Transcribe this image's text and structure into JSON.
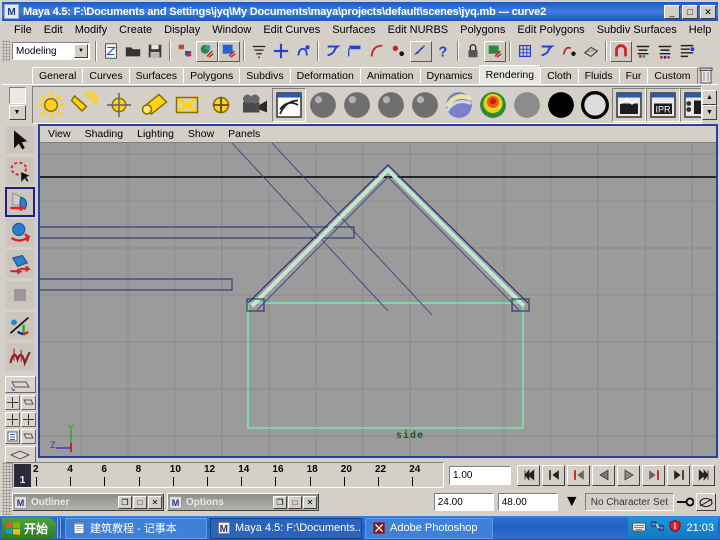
{
  "window": {
    "icon": "maya-icon",
    "title": "Maya 4.5: F:\\Documents and Settings\\jyq\\My Documents\\maya\\projects\\default\\scenes\\jyq.mb  ---  curve2",
    "minimize": "_",
    "maximize": "□",
    "close": "✕"
  },
  "menubar": {
    "items": [
      "File",
      "Edit",
      "Modify",
      "Create",
      "Display",
      "Window",
      "Edit Curves",
      "Surfaces",
      "Edit NURBS",
      "Polygons",
      "Edit Polygons",
      "Subdiv Surfaces",
      "Help"
    ]
  },
  "statusline": {
    "menuset": "Modeling",
    "menuset_arrow": "▼",
    "buttons": [
      {
        "name": "new-scene-button",
        "icon": "new-file-icon"
      },
      {
        "name": "open-scene-button",
        "icon": "open-folder-icon"
      },
      {
        "name": "save-scene-button",
        "icon": "floppy-save-icon"
      },
      {
        "name": "select-by-hierarchy-button",
        "icon": "hierarchy-icon"
      },
      {
        "name": "select-by-object-button",
        "icon": "object-select-icon"
      },
      {
        "name": "select-by-component-button",
        "icon": "component-select-icon"
      },
      {
        "name": "component-mask-button",
        "icon": "mask-lines-icon"
      },
      {
        "name": "points-mask-button",
        "icon": "plus-points-icon"
      },
      {
        "name": "parm-points-mask-button",
        "icon": "curve-points-icon"
      },
      {
        "name": "lines-mask-button",
        "icon": "curve-line-icon"
      },
      {
        "name": "faces-mask-button",
        "icon": "face-icon"
      },
      {
        "name": "hulls-mask-button",
        "icon": "hull-icon"
      },
      {
        "name": "pivots-mask-button",
        "icon": "pivot-icon"
      },
      {
        "name": "handles-mask-button",
        "icon": "handle-sphere-icon"
      },
      {
        "name": "misc-mask-button",
        "icon": "question-icon"
      },
      {
        "name": "lock-selection-button",
        "icon": "lock-icon"
      },
      {
        "name": "highlight-selection-button",
        "icon": "highlight-icon"
      },
      {
        "name": "snap-to-grid-button",
        "icon": "snap-grid-icon"
      },
      {
        "name": "snap-to-curve-button",
        "icon": "snap-curve-icon"
      },
      {
        "name": "snap-to-point-button",
        "icon": "snap-point-icon"
      },
      {
        "name": "snap-to-view-plane-button",
        "icon": "snap-plane-icon"
      },
      {
        "name": "construction-history-button",
        "icon": "history-magnet-icon"
      },
      {
        "name": "render-current-frame-button",
        "icon": "render-frame-icon"
      },
      {
        "name": "irpr-render-button",
        "icon": "ipr-render-icon"
      },
      {
        "name": "render-globals-button",
        "icon": "render-globals-icon"
      }
    ]
  },
  "shelf": {
    "tabs": [
      "General",
      "Curves",
      "Surfaces",
      "Polygons",
      "Subdivs",
      "Deformation",
      "Animation",
      "Dynamics",
      "Rendering",
      "Cloth",
      "Fluids",
      "Fur",
      "Custom"
    ],
    "active_tab": "Rendering",
    "trash_icon": "trash-can-icon",
    "scroll_up": "▲",
    "scroll_down": "▼",
    "items": [
      {
        "name": "ambient-light-button",
        "icon": "sun-light-icon"
      },
      {
        "name": "directional-light-button",
        "icon": "directional-light-icon"
      },
      {
        "name": "point-light-button",
        "icon": "point-light-icon"
      },
      {
        "name": "spot-light-button",
        "icon": "spot-light-icon"
      },
      {
        "name": "area-light-button",
        "icon": "area-light-icon"
      },
      {
        "name": "volume-light-button",
        "icon": "volume-light-icon"
      },
      {
        "name": "create-camera-button",
        "icon": "camera-icon"
      },
      {
        "name": "hypershade-button",
        "icon": "hypershade-icon"
      },
      {
        "name": "lambert-material-button",
        "icon": "gray-sphere-icon"
      },
      {
        "name": "blinn-material-button",
        "icon": "gray-sphere-icon"
      },
      {
        "name": "phong-material-button",
        "icon": "gray-sphere-icon"
      },
      {
        "name": "phonge-material-button",
        "icon": "gray-sphere-icon"
      },
      {
        "name": "anisotropic-material-button",
        "icon": "striped-sphere-icon"
      },
      {
        "name": "ramp-shader-button",
        "icon": "rainbow-sphere-icon"
      },
      {
        "name": "surface-shader-button",
        "icon": "flat-gray-sphere-icon"
      },
      {
        "name": "use-background-button",
        "icon": "black-sphere-icon"
      },
      {
        "name": "layered-shader-button",
        "icon": "outline-sphere-icon"
      },
      {
        "name": "render-view-button",
        "icon": "clapper-icon"
      },
      {
        "name": "ipr-view-button",
        "icon": "clapper-ipr-icon"
      },
      {
        "name": "batch-render-button",
        "icon": "clapper-batch-icon"
      }
    ]
  },
  "toolbox": {
    "tools": [
      {
        "name": "select-tool",
        "icon": "arrow-cursor-icon",
        "selected": false
      },
      {
        "name": "lasso-tool",
        "icon": "lasso-icon",
        "selected": false
      },
      {
        "name": "paint-select-tool",
        "icon": "paint-brush-icon",
        "selected": true
      },
      {
        "name": "move-tool",
        "icon": "move-arrows-icon",
        "selected": false
      },
      {
        "name": "rotate-tool",
        "icon": "rotate-icon",
        "selected": false
      },
      {
        "name": "scale-tool",
        "icon": "scale-icon",
        "selected": false
      },
      {
        "name": "show-manipulator-tool",
        "icon": "manipulator-icon",
        "selected": false
      },
      {
        "name": "last-tool-used",
        "icon": "curve-nurbs-icon",
        "selected": false
      }
    ],
    "layouts": [
      {
        "name": "single-perspective-layout",
        "icon": "single-pane-icon"
      },
      {
        "name": "four-view-layout",
        "icon": "four-pane-icon"
      },
      {
        "name": "two-pane-layout",
        "icon": "two-pane-icon"
      },
      {
        "name": "outliner-persp-layout",
        "icon": "outliner-pane-icon"
      },
      {
        "name": "hypergraph-layout",
        "icon": "hypergraph-pane-icon"
      }
    ]
  },
  "viewport": {
    "panel_menu": [
      "View",
      "Shading",
      "Lighting",
      "Show",
      "Panels"
    ],
    "label": "side",
    "axis": {
      "y": "Y",
      "z": "Z",
      "origin_color": "#cc2222",
      "y_color": "#22aa22",
      "z_color": "#3333cc"
    },
    "colors": {
      "background": "#9b9b9b",
      "grid": "#8c8c8c",
      "axis_line": "#000000",
      "curve": "#3b3f7a",
      "selected": "#66ffaa",
      "border": "#2b3f9e"
    }
  },
  "timeslider": {
    "current_frame": "1",
    "ticks": [
      "2",
      "4",
      "6",
      "8",
      "10",
      "12",
      "14",
      "16",
      "18",
      "20",
      "22",
      "24"
    ],
    "frame_value": "1.00",
    "playback_buttons": [
      {
        "name": "go-to-start-button",
        "icon": "skip-start-icon"
      },
      {
        "name": "step-back-key-button",
        "icon": "prev-key-icon"
      },
      {
        "name": "step-back-frame-button",
        "icon": "prev-frame-icon"
      },
      {
        "name": "play-backwards-button",
        "icon": "play-back-icon"
      },
      {
        "name": "play-forwards-button",
        "icon": "play-forward-icon"
      },
      {
        "name": "step-forward-frame-button",
        "icon": "next-frame-icon"
      },
      {
        "name": "step-forward-key-button",
        "icon": "next-key-icon"
      },
      {
        "name": "go-to-end-button",
        "icon": "skip-end-icon"
      }
    ]
  },
  "rangebar": {
    "windows": [
      {
        "name": "outliner-window",
        "icon": "maya-icon",
        "title": "Outliner",
        "restore": "❐",
        "maximize": "□",
        "close": "✕"
      },
      {
        "name": "options-window",
        "icon": "maya-icon",
        "title": "Options",
        "restore": "❐",
        "maximize": "□",
        "close": "✕"
      }
    ],
    "range_start": "24.00",
    "range_end": "48.00",
    "dropdown_arrow": "▼",
    "character_set": "No Character Set",
    "key_icon": "set-key-icon",
    "anim_icon": "auto-key-icon"
  },
  "taskbar": {
    "start_label": "开始",
    "items": [
      {
        "name": "taskbar-item-notepad",
        "icon": "notepad-icon",
        "label": "建筑教程 - 记事本",
        "active": false
      },
      {
        "name": "taskbar-item-maya",
        "icon": "maya-icon",
        "label": "Maya 4.5: F:\\Documents...",
        "active": true
      },
      {
        "name": "taskbar-item-photoshop",
        "icon": "photoshop-icon",
        "label": "Adobe Photoshop",
        "active": false
      }
    ],
    "tray": [
      {
        "name": "keyboard-tray-icon",
        "icon": "keyboard-icon"
      },
      {
        "name": "network-tray-icon",
        "icon": "network-icon"
      },
      {
        "name": "antivirus-tray-icon",
        "icon": "shield-icon"
      }
    ],
    "clock": "21:03"
  }
}
